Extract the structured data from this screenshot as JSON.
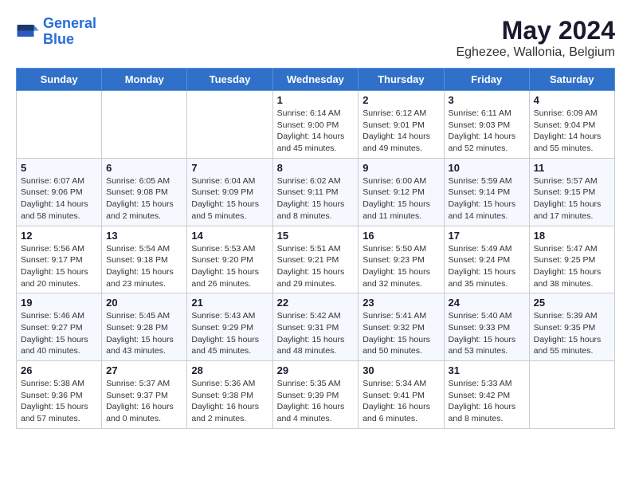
{
  "header": {
    "logo_line1": "General",
    "logo_line2": "Blue",
    "main_title": "May 2024",
    "subtitle": "Eghezee, Wallonia, Belgium"
  },
  "weekdays": [
    "Sunday",
    "Monday",
    "Tuesday",
    "Wednesday",
    "Thursday",
    "Friday",
    "Saturday"
  ],
  "weeks": [
    [
      {
        "day": "",
        "info": ""
      },
      {
        "day": "",
        "info": ""
      },
      {
        "day": "",
        "info": ""
      },
      {
        "day": "1",
        "info": "Sunrise: 6:14 AM\nSunset: 9:00 PM\nDaylight: 14 hours\nand 45 minutes."
      },
      {
        "day": "2",
        "info": "Sunrise: 6:12 AM\nSunset: 9:01 PM\nDaylight: 14 hours\nand 49 minutes."
      },
      {
        "day": "3",
        "info": "Sunrise: 6:11 AM\nSunset: 9:03 PM\nDaylight: 14 hours\nand 52 minutes."
      },
      {
        "day": "4",
        "info": "Sunrise: 6:09 AM\nSunset: 9:04 PM\nDaylight: 14 hours\nand 55 minutes."
      }
    ],
    [
      {
        "day": "5",
        "info": "Sunrise: 6:07 AM\nSunset: 9:06 PM\nDaylight: 14 hours\nand 58 minutes."
      },
      {
        "day": "6",
        "info": "Sunrise: 6:05 AM\nSunset: 9:08 PM\nDaylight: 15 hours\nand 2 minutes."
      },
      {
        "day": "7",
        "info": "Sunrise: 6:04 AM\nSunset: 9:09 PM\nDaylight: 15 hours\nand 5 minutes."
      },
      {
        "day": "8",
        "info": "Sunrise: 6:02 AM\nSunset: 9:11 PM\nDaylight: 15 hours\nand 8 minutes."
      },
      {
        "day": "9",
        "info": "Sunrise: 6:00 AM\nSunset: 9:12 PM\nDaylight: 15 hours\nand 11 minutes."
      },
      {
        "day": "10",
        "info": "Sunrise: 5:59 AM\nSunset: 9:14 PM\nDaylight: 15 hours\nand 14 minutes."
      },
      {
        "day": "11",
        "info": "Sunrise: 5:57 AM\nSunset: 9:15 PM\nDaylight: 15 hours\nand 17 minutes."
      }
    ],
    [
      {
        "day": "12",
        "info": "Sunrise: 5:56 AM\nSunset: 9:17 PM\nDaylight: 15 hours\nand 20 minutes."
      },
      {
        "day": "13",
        "info": "Sunrise: 5:54 AM\nSunset: 9:18 PM\nDaylight: 15 hours\nand 23 minutes."
      },
      {
        "day": "14",
        "info": "Sunrise: 5:53 AM\nSunset: 9:20 PM\nDaylight: 15 hours\nand 26 minutes."
      },
      {
        "day": "15",
        "info": "Sunrise: 5:51 AM\nSunset: 9:21 PM\nDaylight: 15 hours\nand 29 minutes."
      },
      {
        "day": "16",
        "info": "Sunrise: 5:50 AM\nSunset: 9:23 PM\nDaylight: 15 hours\nand 32 minutes."
      },
      {
        "day": "17",
        "info": "Sunrise: 5:49 AM\nSunset: 9:24 PM\nDaylight: 15 hours\nand 35 minutes."
      },
      {
        "day": "18",
        "info": "Sunrise: 5:47 AM\nSunset: 9:25 PM\nDaylight: 15 hours\nand 38 minutes."
      }
    ],
    [
      {
        "day": "19",
        "info": "Sunrise: 5:46 AM\nSunset: 9:27 PM\nDaylight: 15 hours\nand 40 minutes."
      },
      {
        "day": "20",
        "info": "Sunrise: 5:45 AM\nSunset: 9:28 PM\nDaylight: 15 hours\nand 43 minutes."
      },
      {
        "day": "21",
        "info": "Sunrise: 5:43 AM\nSunset: 9:29 PM\nDaylight: 15 hours\nand 45 minutes."
      },
      {
        "day": "22",
        "info": "Sunrise: 5:42 AM\nSunset: 9:31 PM\nDaylight: 15 hours\nand 48 minutes."
      },
      {
        "day": "23",
        "info": "Sunrise: 5:41 AM\nSunset: 9:32 PM\nDaylight: 15 hours\nand 50 minutes."
      },
      {
        "day": "24",
        "info": "Sunrise: 5:40 AM\nSunset: 9:33 PM\nDaylight: 15 hours\nand 53 minutes."
      },
      {
        "day": "25",
        "info": "Sunrise: 5:39 AM\nSunset: 9:35 PM\nDaylight: 15 hours\nand 55 minutes."
      }
    ],
    [
      {
        "day": "26",
        "info": "Sunrise: 5:38 AM\nSunset: 9:36 PM\nDaylight: 15 hours\nand 57 minutes."
      },
      {
        "day": "27",
        "info": "Sunrise: 5:37 AM\nSunset: 9:37 PM\nDaylight: 16 hours\nand 0 minutes."
      },
      {
        "day": "28",
        "info": "Sunrise: 5:36 AM\nSunset: 9:38 PM\nDaylight: 16 hours\nand 2 minutes."
      },
      {
        "day": "29",
        "info": "Sunrise: 5:35 AM\nSunset: 9:39 PM\nDaylight: 16 hours\nand 4 minutes."
      },
      {
        "day": "30",
        "info": "Sunrise: 5:34 AM\nSunset: 9:41 PM\nDaylight: 16 hours\nand 6 minutes."
      },
      {
        "day": "31",
        "info": "Sunrise: 5:33 AM\nSunset: 9:42 PM\nDaylight: 16 hours\nand 8 minutes."
      },
      {
        "day": "",
        "info": ""
      }
    ]
  ]
}
